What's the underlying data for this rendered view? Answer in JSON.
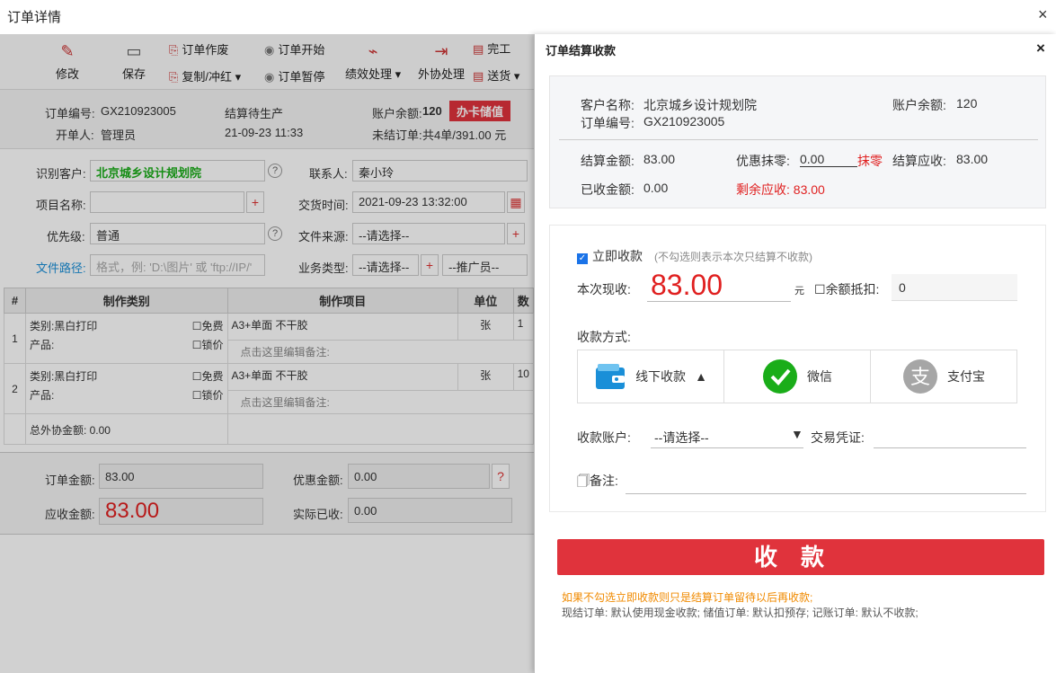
{
  "window": {
    "title": "订单详情",
    "close": "×"
  },
  "toolbar": {
    "edit": "修改",
    "save": "保存",
    "void": "订单作废",
    "copy": "复制/冲红",
    "start": "订单开始",
    "pause": "订单暂停",
    "performance": "绩效处理",
    "outsource": "外协处理",
    "finish": "完工",
    "delivery": "送货"
  },
  "order_info": {
    "order_no_label": "订单编号:",
    "order_no": "GX210923005",
    "status": "结算待生产",
    "balance_label": "账户余额:",
    "balance": "120",
    "recharge": "办卡储值",
    "creator_label": "开单人:",
    "creator": "管理员",
    "created_time": "21-09-23 11:33",
    "unsettled_label": "未结订单:",
    "unsettled": "共4单/391.00 元"
  },
  "form": {
    "customer_label": "识别客户:",
    "customer": "北京城乡设计规划院",
    "contact_label": "联系人:",
    "contact": "秦小玲",
    "project_label": "项目名称:",
    "project": "",
    "delivery_label": "交货时间:",
    "delivery": "2021-09-23 13:32:00",
    "priority_label": "优先级:",
    "priority": "普通",
    "source_label": "文件来源:",
    "source": "--请选择--",
    "path_label": "文件路径:",
    "path_placeholder": "格式，例: 'D:\\图片' 或 'ftp://IP/'",
    "biz_label": "业务类型:",
    "biz": "--请选择--",
    "promoter": "--推广员--"
  },
  "grid": {
    "headers": [
      "#",
      "制作类别",
      "制作项目",
      "单位",
      "数"
    ],
    "rows": [
      {
        "no": "1",
        "category": "类别:黑白打印",
        "product": "产品:",
        "free": "免费",
        "lock": "锁价",
        "item": "A3+单面 不干胶",
        "note": "点击这里编辑备注:",
        "unit": "张",
        "qty": "1"
      },
      {
        "no": "2",
        "category": "类别:黑白打印",
        "product": "产品:",
        "free": "免费",
        "lock": "锁价",
        "item": "A3+单面 不干胶",
        "note": "点击这里编辑备注:",
        "unit": "张",
        "qty": "10"
      }
    ],
    "outsource_total": "总外协金额: 0.00"
  },
  "totals": {
    "order_amount_label": "订单金额:",
    "order_amount": "83.00",
    "discount_label": "优惠金额:",
    "discount": "0.00",
    "receivable_label": "应收金额:",
    "receivable": "83.00",
    "received_label": "实际已收:",
    "received": "0.00"
  },
  "dialog": {
    "title": "订单结算收款",
    "close": "×",
    "customer_label": "客户名称:",
    "customer": "北京城乡设计规划院",
    "balance_label": "账户余额:",
    "balance": "120",
    "order_no_label": "订单编号:",
    "order_no": "GX210923005",
    "settle_label": "结算金额:",
    "settle": "83.00",
    "discount_label": "优惠抹零:",
    "discount": "0.00",
    "round": "抹零",
    "settle_due_label": "结算应收:",
    "settle_due": "83.00",
    "collected_label": "已收金额:",
    "collected": "0.00",
    "remaining": "剩余应收: 83.00",
    "instant_label": "立即收款",
    "instant_hint": "(不勾选则表示本次只结算不收款)",
    "cash_label": "本次现收:",
    "cash": "83.00",
    "yuan": "元",
    "balance_deduct_label": "余额抵扣:",
    "balance_deduct": "0",
    "method_label": "收款方式:",
    "methods": [
      "线下收款",
      "微信",
      "支付宝"
    ],
    "account_label": "收款账户:",
    "account": "--请选择--",
    "voucher_label": "交易凭证:",
    "remark_label": "备注:",
    "collect_button": "收款",
    "note1": "如果不勾选立即收款则只是结算订单留待以后再收款;",
    "note2": "现结订单: 默认使用现金收款; 储值订单: 默认扣预存; 记账订单: 默认不收款;"
  },
  "colors": {
    "accent": "#e0333c",
    "green": "#1aad19",
    "blue": "#1a8fd8",
    "highlight": "#e02020"
  }
}
